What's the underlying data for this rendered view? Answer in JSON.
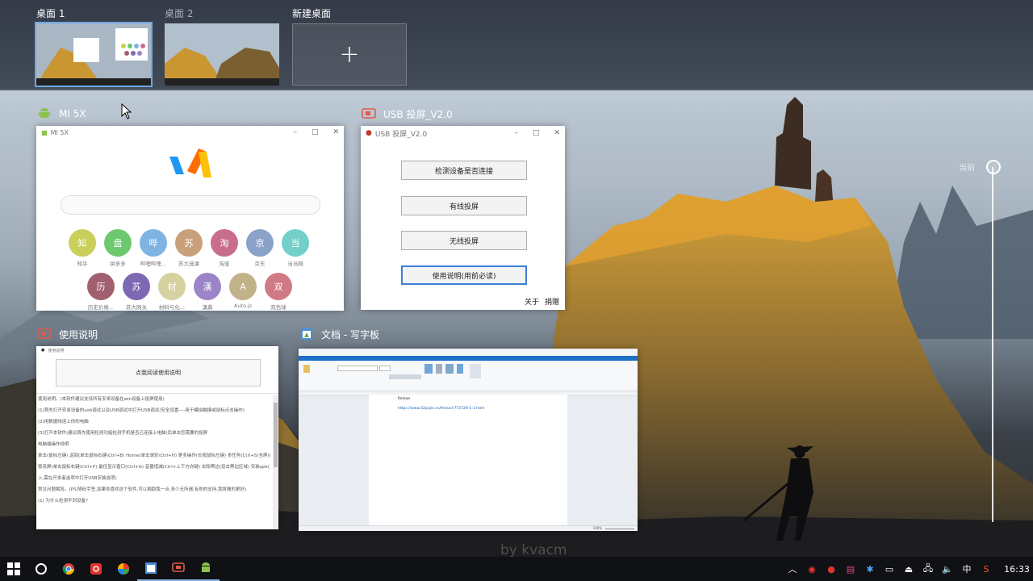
{
  "virtual_desktops": {
    "items": [
      {
        "label": "桌面 1",
        "active": true
      },
      {
        "label": "桌面 2",
        "active": false
      }
    ],
    "new_label": "新建桌面",
    "new_symbol": "+"
  },
  "windows": {
    "mi": {
      "header": "MI 5X",
      "title": "MI 5X",
      "apps_row1": [
        {
          "glyph": "知",
          "name": "知乎",
          "color": "#c9cf5a"
        },
        {
          "glyph": "盘",
          "name": "拼多多",
          "color": "#6cc96f"
        },
        {
          "glyph": "哔",
          "name": "哔哩哔哩...",
          "color": "#7fb3e3"
        },
        {
          "glyph": "苏",
          "name": "苏大选课",
          "color": "#c9a07c"
        },
        {
          "glyph": "淘",
          "name": "淘宝",
          "color": "#c96d8f"
        },
        {
          "glyph": "京",
          "name": "京东",
          "color": "#8aa2c8"
        },
        {
          "glyph": "当",
          "name": "当当网",
          "color": "#72cfc9"
        }
      ],
      "apps_row2": [
        {
          "glyph": "历",
          "name": "历史价格...",
          "color": "#a06070"
        },
        {
          "glyph": "苏",
          "name": "苏大网关",
          "color": "#7d68b3"
        },
        {
          "glyph": "材",
          "name": "材料与化...",
          "color": "#d5d1a0"
        },
        {
          "glyph": "漢",
          "name": "漢典",
          "color": "#9c84c9"
        },
        {
          "glyph": "A",
          "name": "Auto.js",
          "color": "#c2b28a"
        },
        {
          "glyph": "双",
          "name": "双色球",
          "color": "#d07a86"
        }
      ]
    },
    "usb": {
      "header": "USB 投屏_V2.0",
      "title": "USB 投屏_V2.0",
      "buttons": [
        "检测设备是否连接",
        "有线投屏",
        "无线投屏",
        "使用说明(用前必读)"
      ],
      "footer_about": "关于",
      "footer_donate": "捐赠"
    },
    "instructions": {
      "header": "使用说明",
      "title": "使用说明",
      "read_button": "点我阅读使用说明",
      "lines": [
        "使用说明。(本软件建议支持所有安卓设备在win设备上投屏使用)",
        "(1)首先打开安卓设备的usb调试以及USB调试中打开USB调试(安全设置----用于模拟触摸或鼠标点击操作)",
        "(2)用数据线连上你的电脑",
        "(3)打开本软件(建议首先使用检测功能检测手机是否已连接上电脑)后单击您需要的投屏",
        "电脑端操作说明",
        "单击(鼠标左键) 返回(单击鼠标右键\\Ctrl+B) Home(单击滚轮\\Ctrl+H) 更多操作(长按鼠标左键) 多任务(Ctrl+S)全屏(Ctrl+F)",
        "锁亮屏(单击鼠标右键\\Ctrl+P) 最佳显示窗口(Ctrl+G) 音量增减(Ctrl+上下方向键) 去除黑边(双击黑边区域) 安装apk(直接拖",
        "入,需在开发者选项中打开USB安装选项)",
        "常见问题解答。(PS:随码手签,如果你喜欢这个软件,可以捐助我一点,多少无所谓,有你的支持,我将做的更好)",
        "(1) 为什么检测不到设备?"
      ]
    },
    "wordpad": {
      "header": "文档 - 写字板",
      "doc_line1": "Reloan",
      "doc_line2": "https://www.52pojie.cn/thread-773729-1-1.html",
      "zoom": "100%"
    }
  },
  "timeline": {
    "label": "当前"
  },
  "watermark": "by kvacm",
  "taskbar": {
    "ime": "中",
    "clock": "16:33"
  }
}
